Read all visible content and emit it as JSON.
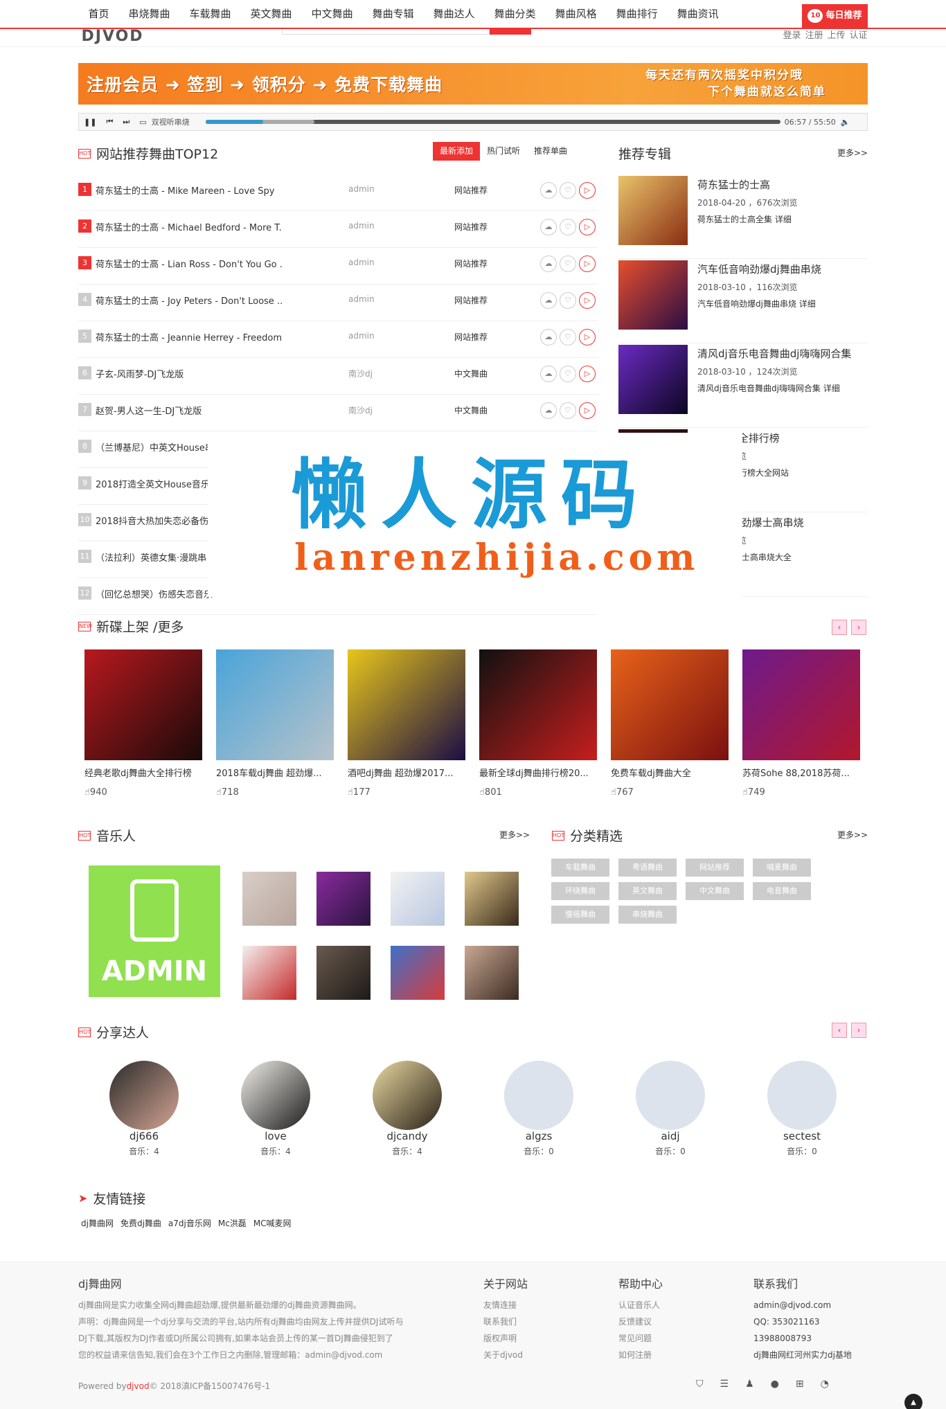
{
  "nav": {
    "items": [
      "首页",
      "串烧舞曲",
      "车载舞曲",
      "英文舞曲",
      "中文舞曲",
      "舞曲专辑",
      "舞曲达人",
      "舞曲分类",
      "舞曲风格",
      "舞曲排行",
      "舞曲资讯"
    ],
    "daily": "每日推荐",
    "daily_badge": "10"
  },
  "header": {
    "logo": "DJVOD",
    "user_links": [
      "登录",
      "注册",
      "上传",
      "认证"
    ]
  },
  "banner": {
    "left": "注册会员 ➜ 签到 ➜ 领积分 ➜ 免费下载舞曲",
    "right_line1": "每天还有两次摇奖中积分哦",
    "right_line2": "下个舞曲就这么简单"
  },
  "player": {
    "track": "双视听串烧",
    "time": "06:57 / 55:50",
    "progress_played": 0.1,
    "progress_loaded": 0.19
  },
  "top12": {
    "title": "网站推荐舞曲TOP12",
    "tabs": [
      "最新添加",
      "热门试听",
      "推荐单曲"
    ],
    "songs": [
      {
        "no": "1",
        "name": "荷东猛士的士高 - Mike Mareen - Love Spy",
        "user": "admin",
        "cat": "网站推荐"
      },
      {
        "no": "2",
        "name": "荷东猛士的士高 - Michael Bedford - More T...",
        "user": "admin",
        "cat": "网站推荐"
      },
      {
        "no": "3",
        "name": "荷东猛士的士高 - Lian Ross - Don't You Go ...",
        "user": "admin",
        "cat": "网站推荐"
      },
      {
        "no": "4",
        "name": "荷东猛士的士高 - Joy Peters - Don't Loose ...",
        "user": "admin",
        "cat": "网站推荐"
      },
      {
        "no": "5",
        "name": "荷东猛士的士高 - Jeannie Herrey - Freedom...",
        "user": "admin",
        "cat": "网站推荐"
      },
      {
        "no": "6",
        "name": "子玄-风雨梦-DJ飞龙版",
        "user": "南沙dj",
        "cat": "中文舞曲"
      },
      {
        "no": "7",
        "name": "赵贺-男人这一生-DJ飞龙版",
        "user": "南沙dj",
        "cat": "中文舞曲"
      },
      {
        "no": "8",
        "name": "（兰博基尼）中英文House串",
        "user": "",
        "cat": ""
      },
      {
        "no": "9",
        "name": "2018打造全英文House音乐串",
        "user": "",
        "cat": ""
      },
      {
        "no": "10",
        "name": "2018抖音大热加失恋必备伤感",
        "user": "",
        "cat": ""
      },
      {
        "no": "11",
        "name": "（法拉利）英德女集·漫跳串",
        "user": "",
        "cat": ""
      },
      {
        "no": "12",
        "name": "（回忆总想哭）伤感失恋音乐",
        "user": "",
        "cat": ""
      }
    ]
  },
  "albums": {
    "title": "推荐专辑",
    "more": "更多>>",
    "items": [
      {
        "title": "荷东猛士的士高",
        "meta": "2018-04-20 ，676次浏览",
        "desc": "荷东猛士的士高全集   详细"
      },
      {
        "title": "汽车低音响劲爆dj舞曲串烧",
        "meta": "2018-03-10 ，116次浏览",
        "desc": "汽车低音响劲爆dj舞曲串烧   详细"
      },
      {
        "title": "清风dj音乐电音舞曲dj嗨嗨网合集",
        "meta": "2018-03-10 ，124次浏览",
        "desc": "清风dj音乐电音舞曲dj嗨嗨网合集   详细"
      },
      {
        "title": "dj舞曲大全排行榜",
        "meta": "，940次浏览",
        "desc": "舞曲大全排行榜大全网站"
      },
      {
        "title": "dj舞曲 超劲爆士高串烧",
        "meta": "，718次浏览",
        "desc": "舞曲 超劲爆士高串烧大全"
      }
    ]
  },
  "watermark": {
    "big": "懒人源码",
    "small": "lanrenzhijia.com"
  },
  "newalbums": {
    "title": "新碟上架 /更多",
    "items": [
      {
        "name": "经典老歌dj舞曲大全排行榜",
        "count": "940"
      },
      {
        "name": "2018车载dj舞曲 超劲爆...",
        "count": "718"
      },
      {
        "name": "酒吧dj舞曲 超劲爆2017...",
        "count": "177"
      },
      {
        "name": "最新全球dj舞曲排行榜20...",
        "count": "801"
      },
      {
        "name": "免费车载dj舞曲大全",
        "count": "767"
      },
      {
        "name": "苏荷Sohe 88,2018苏荷...",
        "count": "749"
      }
    ]
  },
  "musicians": {
    "title": "音乐人",
    "more": "更多>>",
    "admin_label": "ADMIN"
  },
  "categories": {
    "title": "分类精选",
    "more": "更多>>",
    "items": [
      "车载舞曲",
      "粤语舞曲",
      "网站推荐",
      "喊麦舞曲",
      "环绕舞曲",
      "英文舞曲",
      "中文舞曲",
      "电音舞曲",
      "慢摇舞曲",
      "串烧舞曲"
    ]
  },
  "sharers": {
    "title": "分享达人",
    "items": [
      {
        "name": "dj666",
        "count": "音乐：4"
      },
      {
        "name": "love",
        "count": "音乐：4"
      },
      {
        "name": "djcandy",
        "count": "音乐：4"
      },
      {
        "name": "algzs",
        "count": "音乐：0"
      },
      {
        "name": "aidj",
        "count": "音乐：0"
      },
      {
        "name": "sectest",
        "count": "音乐：0"
      }
    ]
  },
  "links": {
    "title": "友情链接",
    "items": [
      "dj舞曲网",
      "免费dj舞曲",
      "a7dj音乐网",
      "Mc洪磊",
      "MC喊麦网"
    ]
  },
  "footer": {
    "about_title": "dj舞曲网",
    "about_lines": [
      "dj舞曲网是实力收集全网dj舞曲超劲爆,提供最新最劲爆的dj舞曲资源舞曲网。",
      "声明：dj舞曲网是一个dj分享与交流的平台,站内所有dj舞曲均由网友上传并提供DJ试听与",
      "DJ下载,其版权为DJ作者或DJ所属公司拥有,如果本站会员上传的某一首DJ舞曲侵犯到了",
      "您的权益请来信告知,我们会在3个工作日之内删除,管理邮箱：admin@djvod.com"
    ],
    "site_title": "关于网站",
    "site_links": [
      "友情连接",
      "联系我们",
      "版权声明",
      "关于djvod"
    ],
    "help_title": "帮助中心",
    "help_links": [
      "认证音乐人",
      "反馈建议",
      "常见问题",
      "如何注册"
    ],
    "contact_title": "联系我们",
    "contact_lines": [
      "admin@djvod.com",
      "QQ: 353021163",
      "13988008793",
      "dj舞曲网红河州实力dj基地"
    ],
    "copyright_pre": "Powered by",
    "copyright_brand": "djvod",
    "copyright_post": "© 2018滇ICP备15007476号-1"
  }
}
